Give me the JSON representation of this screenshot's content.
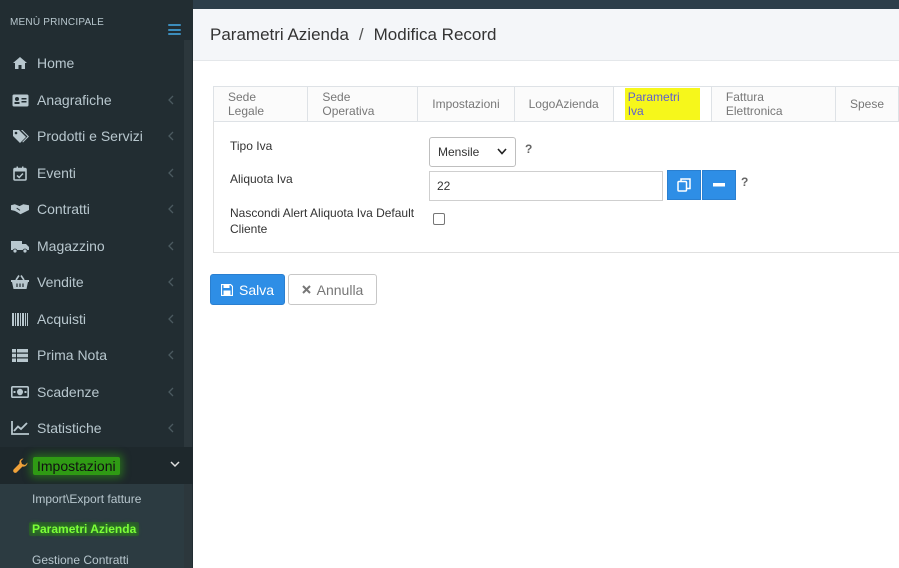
{
  "sidebar": {
    "header": "MENÙ PRINCIPALE",
    "items": [
      {
        "label": "Home",
        "icon": "home-icon"
      },
      {
        "label": "Anagrafiche",
        "icon": "id-card-icon"
      },
      {
        "label": "Prodotti e Servizi",
        "icon": "tags-icon"
      },
      {
        "label": "Eventi",
        "icon": "calendar-check-icon"
      },
      {
        "label": "Contratti",
        "icon": "handshake-icon"
      },
      {
        "label": "Magazzino",
        "icon": "truck-icon"
      },
      {
        "label": "Vendite",
        "icon": "basket-icon"
      },
      {
        "label": "Acquisti",
        "icon": "barcode-icon"
      },
      {
        "label": "Prima Nota",
        "icon": "list-icon"
      },
      {
        "label": "Scadenze",
        "icon": "money-icon"
      },
      {
        "label": "Statistiche",
        "icon": "line-chart-icon"
      },
      {
        "label": "Impostazioni",
        "icon": "wrench-icon"
      }
    ],
    "subitems": [
      {
        "label": "Import\\Export fatture"
      },
      {
        "label": "Parametri Azienda"
      },
      {
        "label": "Gestione Contratti"
      }
    ]
  },
  "header": {
    "title": "Parametri Azienda",
    "separator": "/",
    "subtitle": "Modifica Record"
  },
  "tabs": [
    {
      "label": "Sede Legale"
    },
    {
      "label": "Sede Operativa"
    },
    {
      "label": "Impostazioni"
    },
    {
      "label": "LogoAzienda"
    },
    {
      "label": "Parametri Iva"
    },
    {
      "label": "Fattura Elettronica"
    },
    {
      "label": "Spese"
    }
  ],
  "form": {
    "tipo_iva_label": "Tipo Iva",
    "tipo_iva_value": "Mensile",
    "aliquota_label": "Aliquota Iva",
    "aliquota_value": "22",
    "nascondi_label_1": "Nascondi Alert Aliquota Iva Default",
    "nascondi_label_2": "Cliente",
    "help": "?"
  },
  "actions": {
    "save_label": "Salva",
    "cancel_label": "Annulla"
  },
  "colors": {
    "sidebar_bg": "#222d32",
    "accent": "#2e8ee6",
    "highlight_yellow": "#f6f71b",
    "highlight_green": "#2f9a14"
  }
}
